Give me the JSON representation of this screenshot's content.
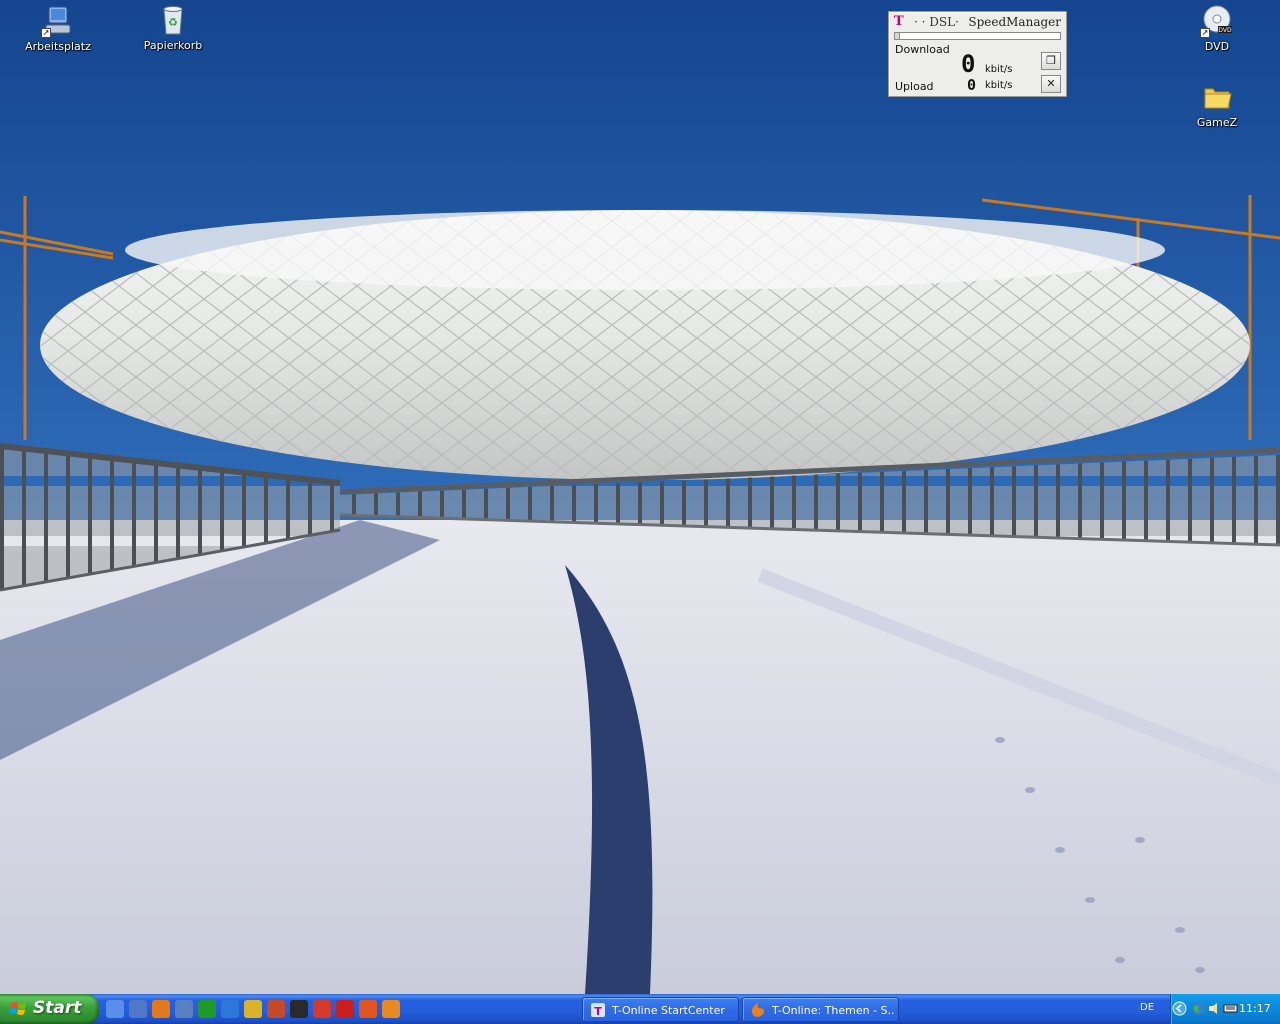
{
  "desktop": {
    "icons": [
      {
        "label": "Arbeitsplatz",
        "icon": "my-computer-icon"
      },
      {
        "label": "Papierkorb",
        "icon": "recycle-bin-icon"
      },
      {
        "label": "DVD",
        "icon": "dvd-drive-icon"
      },
      {
        "label": "GameZ",
        "icon": "folder-icon"
      }
    ],
    "wallpaper": "snow-covered stadium with bridge"
  },
  "speedmanager": {
    "brand": "T",
    "dsl_text": "· · DSL·",
    "title": "SpeedManager",
    "download_label": "Download",
    "download_value": "0",
    "download_unit": "kbit/s",
    "upload_label": "Upload",
    "upload_value": "0",
    "upload_unit": "kbit/s",
    "meter_fill": 0.03
  },
  "taskbar": {
    "start_label": "Start",
    "quicklaunch": [
      {
        "icon": "show-desktop-icon",
        "color": "#5b8ee8"
      },
      {
        "icon": "t-online-icon",
        "color": "#4f78c8"
      },
      {
        "icon": "firefox-icon",
        "color": "#e07a1c"
      },
      {
        "icon": "thunderbird-icon",
        "color": "#5a7fc0"
      },
      {
        "icon": "clover-icon",
        "color": "#1f9a2a"
      },
      {
        "icon": "internet-explorer-icon",
        "color": "#2b78d8"
      },
      {
        "icon": "pencil-icon",
        "color": "#d9b42a"
      },
      {
        "icon": "paint-icon",
        "color": "#c24a2a"
      },
      {
        "icon": "console-icon",
        "color": "#2a2a2a"
      },
      {
        "icon": "media-player-icon",
        "color": "#d23a2a"
      },
      {
        "icon": "acrobat-icon",
        "color": "#c81e1e"
      },
      {
        "icon": "record-icon",
        "color": "#e05520"
      },
      {
        "icon": "burn-icon",
        "color": "#e88a20"
      }
    ],
    "tasks": [
      {
        "label": "T-Online StartCenter",
        "icon": "t-online-icon"
      },
      {
        "label": "T-Online: Themen - S...",
        "icon": "firefox-icon"
      }
    ],
    "language": "DE",
    "clock": "11:17",
    "tray_icons": [
      "collapse-tray-icon",
      "network-globe-icon",
      "volume-icon",
      "keyboard-icon"
    ]
  }
}
